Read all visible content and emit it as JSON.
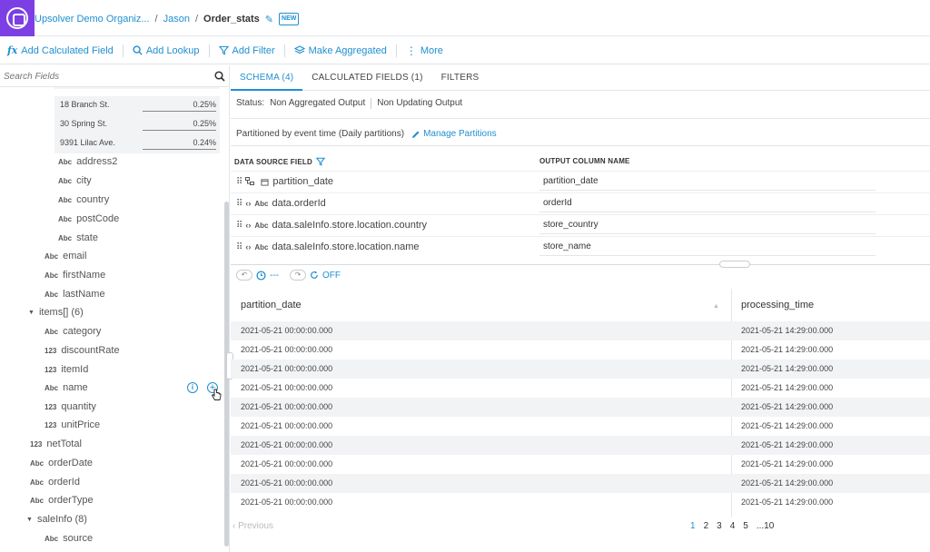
{
  "header": {
    "breadcrumbs": [
      {
        "label": "Upsolver Demo Organiz..."
      },
      {
        "label": "Jason"
      },
      {
        "label": "Order_stats"
      }
    ],
    "separator": "/",
    "new_badge": "NEW",
    "pencil_glyph": "✎"
  },
  "toolbar": {
    "items": [
      {
        "icon": "fx-icon",
        "glyph": "fx",
        "label": "Add Calculated Field"
      },
      {
        "icon": "search-icon",
        "glyph": "",
        "label": "Add Lookup"
      },
      {
        "icon": "filter-icon",
        "glyph": "",
        "label": "Add Filter"
      },
      {
        "icon": "layers-icon",
        "glyph": "",
        "label": "Make Aggregated"
      },
      {
        "icon": "more-vertical-icon",
        "glyph": "⋮",
        "label": "More"
      }
    ]
  },
  "left_panel": {
    "search_placeholder": "Search Fields",
    "value_stats": [
      {
        "address": "18 Branch St.",
        "percent": "0.25%"
      },
      {
        "address": "30 Spring St.",
        "percent": "0.25%"
      },
      {
        "address": "9391 Lilac Ave.",
        "percent": "0.24%"
      }
    ],
    "tree": [
      {
        "type": "Abc",
        "name": "address2"
      },
      {
        "type": "Abc",
        "name": "city"
      },
      {
        "type": "Abc",
        "name": "country"
      },
      {
        "type": "Abc",
        "name": "postCode"
      },
      {
        "type": "Abc",
        "name": "state"
      },
      {
        "type": "Abc",
        "name": "email"
      },
      {
        "type": "Abc",
        "name": "firstName"
      },
      {
        "type": "Abc",
        "name": "lastName"
      },
      {
        "type": "group",
        "name": "items[] (6)"
      },
      {
        "type": "Abc",
        "name": "category"
      },
      {
        "type": "123",
        "name": "discountRate"
      },
      {
        "type": "123",
        "name": "itemId"
      },
      {
        "type": "Abc",
        "name": "name"
      },
      {
        "type": "123",
        "name": "quantity"
      },
      {
        "type": "123",
        "name": "unitPrice"
      },
      {
        "type": "123",
        "name": "netTotal"
      },
      {
        "type": "Abc",
        "name": "orderDate"
      },
      {
        "type": "Abc",
        "name": "orderId"
      },
      {
        "type": "Abc",
        "name": "orderType"
      },
      {
        "type": "group",
        "name": "saleInfo (8)"
      },
      {
        "type": "Abc",
        "name": "source"
      }
    ],
    "caret_glyph": "▼",
    "info_glyph": "i",
    "add_glyph": "+"
  },
  "main": {
    "tabs": [
      {
        "label": "SCHEMA (4)",
        "active": true
      },
      {
        "label": "CALCULATED FIELDS (1)",
        "active": false
      },
      {
        "label": "FILTERS",
        "active": false
      }
    ],
    "status_label": "Status:",
    "status_values": [
      "Non Aggregated Output",
      "Non Updating Output"
    ],
    "partition_text": "Partitioned by event time (Daily partitions)",
    "manage_partitions": "Manage Partitions",
    "column_headers": {
      "source": "DATA SOURCE FIELD",
      "output": "OUTPUT COLUMN NAME"
    },
    "mappings": [
      {
        "tag": "",
        "source": "partition_date",
        "output": "partition_date"
      },
      {
        "tag": "Abc",
        "source": "data.orderId",
        "output": "orderId"
      },
      {
        "tag": "Abc",
        "source": "data.saleInfo.store.location.country",
        "output": "store_country"
      },
      {
        "tag": "Abc",
        "source": "data.saleInfo.store.location.name",
        "output": "store_name"
      }
    ],
    "controls": {
      "dash": "---",
      "live_state": "OFF"
    },
    "preview": {
      "columns": [
        "partition_date",
        "processing_time"
      ],
      "rows": [
        [
          "2021-05-21 00:00:00.000",
          "2021-05-21 14:29:00.000"
        ],
        [
          "2021-05-21 00:00:00.000",
          "2021-05-21 14:29:00.000"
        ],
        [
          "2021-05-21 00:00:00.000",
          "2021-05-21 14:29:00.000"
        ],
        [
          "2021-05-21 00:00:00.000",
          "2021-05-21 14:29:00.000"
        ],
        [
          "2021-05-21 00:00:00.000",
          "2021-05-21 14:29:00.000"
        ],
        [
          "2021-05-21 00:00:00.000",
          "2021-05-21 14:29:00.000"
        ],
        [
          "2021-05-21 00:00:00.000",
          "2021-05-21 14:29:00.000"
        ],
        [
          "2021-05-21 00:00:00.000",
          "2021-05-21 14:29:00.000"
        ],
        [
          "2021-05-21 00:00:00.000",
          "2021-05-21 14:29:00.000"
        ],
        [
          "2021-05-21 00:00:00.000",
          "2021-05-21 14:29:00.000"
        ]
      ]
    },
    "pagination": {
      "previous": "‹ Previous",
      "pages": [
        "1",
        "2",
        "3",
        "4",
        "5",
        "...10"
      ],
      "current": "1"
    }
  },
  "colors": {
    "accent": "#1f8fd1",
    "logo": "#7b3fe4",
    "stripe": "#f2f3f5"
  }
}
